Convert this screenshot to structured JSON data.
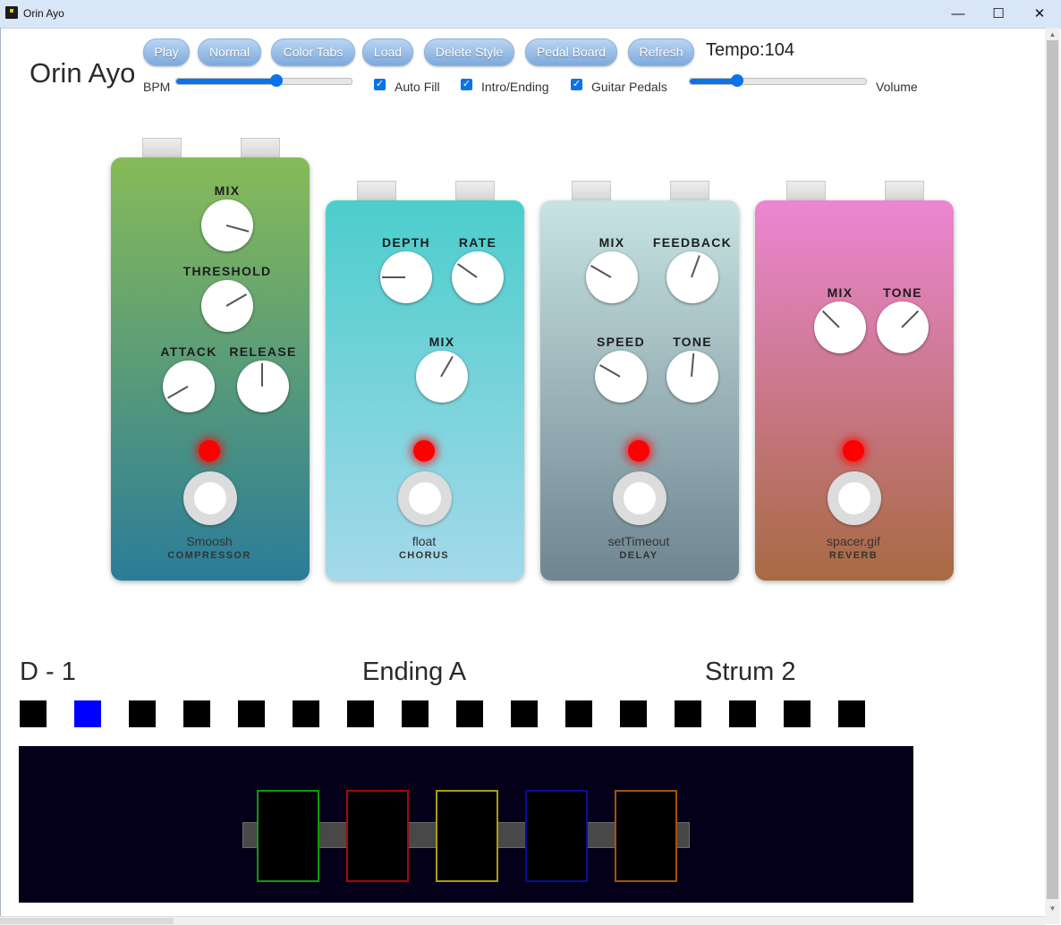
{
  "window": {
    "title": "Orin Ayo"
  },
  "header": {
    "app_name": "Orin Ayo",
    "buttons": [
      "Play",
      "Normal",
      "Color Tabs",
      "Load",
      "Delete Style",
      "Pedal Board",
      "Refresh"
    ],
    "tempo_text": "Tempo:104",
    "bpm_label": "BPM",
    "bpm_slider_fraction": 0.57,
    "volume_label": "Volume",
    "volume_slider_fraction": 0.27,
    "checkboxes": [
      {
        "label": "Auto Fill",
        "checked": true
      },
      {
        "label": "Intro/Ending",
        "checked": true
      },
      {
        "label": "Guitar Pedals",
        "checked": true
      }
    ]
  },
  "pedals": [
    {
      "name": "Smoosh",
      "type": "COMPRESSOR",
      "gradient": [
        "#87bb58",
        "#2b7c99"
      ],
      "knobs": [
        {
          "label": "MIX",
          "angle_deg": 15
        },
        {
          "label": "THRESHOLD",
          "angle_deg": -30
        },
        {
          "label": "ATTACK",
          "angle_deg": 150
        },
        {
          "label": "RELEASE",
          "angle_deg": -90
        }
      ]
    },
    {
      "name": "float",
      "type": "CHORUS",
      "gradient": [
        "#4ccdcc",
        "#a4d9ea"
      ],
      "knobs": [
        {
          "label": "DEPTH",
          "angle_deg": 180
        },
        {
          "label": "RATE",
          "angle_deg": 215
        },
        {
          "label": "MIX",
          "angle_deg": -60
        }
      ]
    },
    {
      "name": "setTimeout",
      "type": "DELAY",
      "gradient": [
        "#c7e3e2",
        "#6f8591"
      ],
      "knobs": [
        {
          "label": "MIX",
          "angle_deg": 210
        },
        {
          "label": "FEEDBACK",
          "angle_deg": -70
        },
        {
          "label": "SPEED",
          "angle_deg": 210
        },
        {
          "label": "TONE",
          "angle_deg": -85
        }
      ]
    },
    {
      "name": "spacer.gif",
      "type": "REVERB",
      "gradient": [
        "#ec86d3",
        "#a86a42"
      ],
      "knobs": [
        {
          "label": "MIX",
          "angle_deg": 225
        },
        {
          "label": "TONE",
          "angle_deg": -45
        }
      ]
    }
  ],
  "status": {
    "chord": "D - 1",
    "section": "Ending A",
    "strum": "Strum 2"
  },
  "beats": {
    "count": 16,
    "active_index": 1,
    "active_color": "#0000ff",
    "inactive_color": "#000000"
  },
  "footboard": {
    "pedal_colors": [
      "#0c9c0c",
      "#a30b0b",
      "#a89d0c",
      "#0c0c9a",
      "#a3530b"
    ]
  }
}
